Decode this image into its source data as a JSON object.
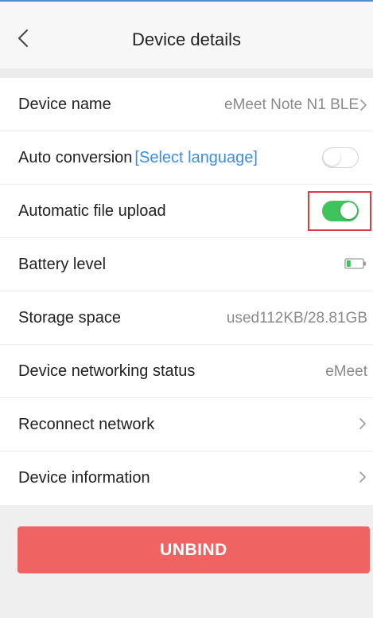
{
  "header": {
    "title": "Device details",
    "back_icon": "chevron-left-icon"
  },
  "rows": {
    "device_name": {
      "label": "Device name",
      "value": "eMeet Note N1 BLE"
    },
    "auto_conversion": {
      "label": "Auto conversion",
      "link": "[Select language]",
      "toggle_state": "off"
    },
    "auto_upload": {
      "label": "Automatic file upload",
      "toggle_state": "on"
    },
    "battery": {
      "label": "Battery level",
      "icon": "battery-icon",
      "level": 0.25
    },
    "storage": {
      "label": "Storage space",
      "value": "used112KB/28.81GB"
    },
    "network_status": {
      "label": "Device networking status",
      "value": "eMeet"
    },
    "reconnect": {
      "label": "Reconnect network"
    },
    "device_info": {
      "label": "Device information"
    }
  },
  "unbind_button": {
    "label": "UNBIND"
  },
  "colors": {
    "accent_link": "#3a8ee6",
    "toggle_on": "#3ec45a",
    "danger_button": "#f06363",
    "highlight_box": "#e23b3b",
    "battery_fill": "#3ec45a"
  }
}
